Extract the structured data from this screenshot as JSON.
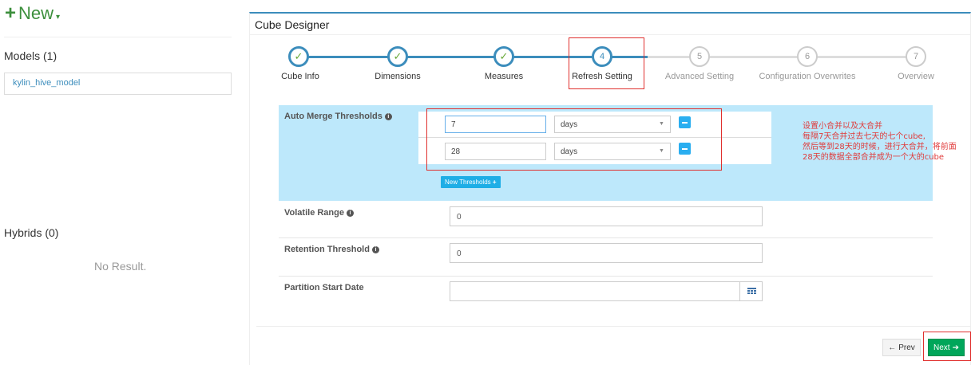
{
  "sidebar": {
    "new_label": "New",
    "models_title": "Models (1)",
    "models": [
      "kylin_hive_model"
    ],
    "hybrids_title": "Hybrids (0)",
    "no_result": "No Result."
  },
  "designer": {
    "title": "Cube Designer",
    "steps": [
      {
        "num": "✓",
        "label": "Cube Info",
        "state": "done"
      },
      {
        "num": "✓",
        "label": "Dimensions",
        "state": "done"
      },
      {
        "num": "✓",
        "label": "Measures",
        "state": "done"
      },
      {
        "num": "4",
        "label": "Refresh Setting",
        "state": "active"
      },
      {
        "num": "5",
        "label": "Advanced Setting",
        "state": "todo"
      },
      {
        "num": "6",
        "label": "Configuration Overwrites",
        "state": "todo"
      },
      {
        "num": "7",
        "label": "Overview",
        "state": "todo"
      }
    ]
  },
  "form": {
    "auto_merge_label": "Auto Merge Thresholds",
    "thresholds": [
      {
        "value": "7",
        "unit": "days"
      },
      {
        "value": "28",
        "unit": "days"
      }
    ],
    "new_thresholds_label": "New Thresholds",
    "volatile_label": "Volatile Range",
    "volatile_value": "0",
    "retention_label": "Retention Threshold",
    "retention_value": "0",
    "partition_label": "Partition Start Date",
    "partition_value": ""
  },
  "annotation": [
    "设置小合并以及大合并",
    "每隔7天合并过去七天的七个cube,",
    "然后等到28天的时候，进行大合并，将前面",
    "28天的数据全部合并成为一个大的cube"
  ],
  "footer": {
    "prev_label": "Prev",
    "next_label": "Next"
  },
  "colors": {
    "primary": "#3c8dbc",
    "success": "#00a65a",
    "highlight_bg": "#bde8fb",
    "annotation": "#e03a3a"
  }
}
